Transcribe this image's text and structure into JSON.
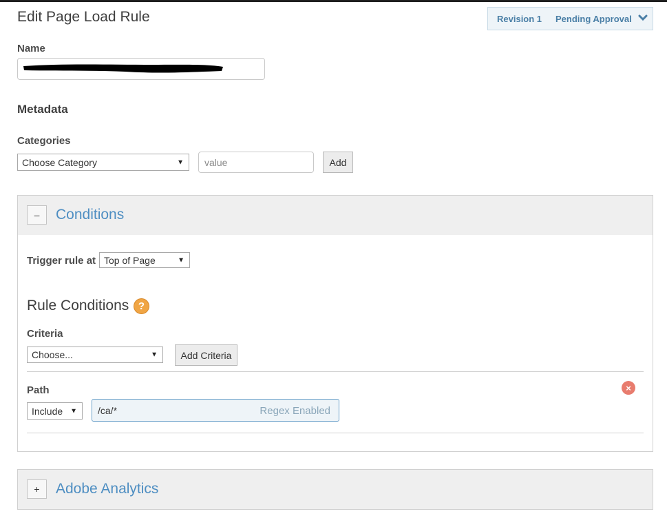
{
  "page": {
    "title": "Edit Page Load Rule"
  },
  "revision": {
    "revision_label": "Revision 1",
    "status_label": "Pending Approval",
    "toggle_icon": "chevron-down-icon"
  },
  "name_field": {
    "label": "Name",
    "value": "(redacted)"
  },
  "metadata": {
    "heading": "Metadata",
    "categories_label": "Categories",
    "category_select_value": "Choose Category",
    "value_placeholder": "value",
    "add_label": "Add"
  },
  "conditions": {
    "title": "Conditions",
    "toggle_label": "–",
    "trigger_label": "Trigger rule at",
    "trigger_value": "Top of Page",
    "rule_conditions_title": "Rule Conditions",
    "help_icon_text": "?",
    "criteria_label": "Criteria",
    "criteria_value": "Choose...",
    "add_criteria_label": "Add Criteria",
    "path": {
      "label": "Path",
      "include_value": "Include",
      "path_value": "/ca/*",
      "regex_hint": "Regex Enabled",
      "remove_icon_text": "×"
    }
  },
  "analytics": {
    "title": "Adobe Analytics",
    "toggle_label": "+"
  },
  "colors": {
    "accent": "#4e8ec2",
    "help": "#f0a544",
    "remove": "#e87c6e"
  }
}
